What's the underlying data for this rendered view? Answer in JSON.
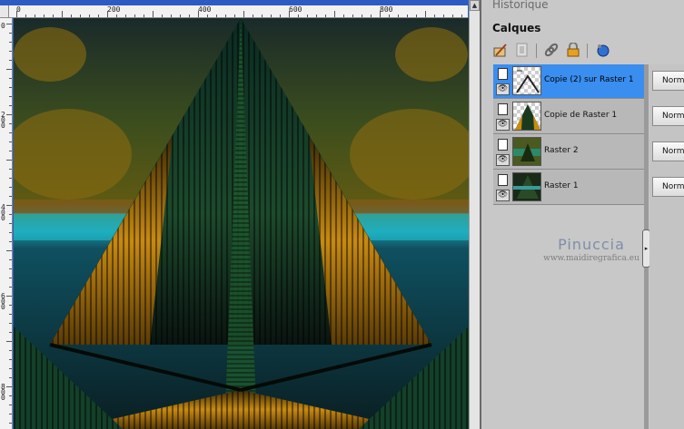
{
  "canvas_window": {
    "ruler_h_labels": [
      "0",
      "200",
      "400",
      "600",
      "800"
    ],
    "ruler_v_labels": [
      "0",
      "2 0 0",
      "4 0 0",
      "6 0 0",
      "8 0 0"
    ],
    "scroll_up_glyph": "▲",
    "image_description_icon": "kaleidoscope-image"
  },
  "palettes": {
    "history_title": "Historique",
    "layers_title": "Calques",
    "toolbar_icons": [
      "new-raster-layer-icon",
      "new-mask-layer-icon",
      "link-icon",
      "lock-icon",
      "layer-effects-icon"
    ],
    "layers": [
      {
        "name": "Copie (2) sur Raster 1",
        "selected": true,
        "blend": "Norm",
        "thumb": "transparent-sketch"
      },
      {
        "name": "Copie de Raster 1",
        "selected": false,
        "blend": "Norm",
        "thumb": "triangle"
      },
      {
        "name": "Raster 2",
        "selected": false,
        "blend": "Norm",
        "thumb": "green-pattern"
      },
      {
        "name": "Raster 1",
        "selected": false,
        "blend": "Norm",
        "thumb": "dark-pattern"
      }
    ],
    "splitter_glyph": "▸",
    "watermark_name": "Pinuccia",
    "watermark_url": "www.maidiregrafica.eu"
  },
  "colors": {
    "selected_layer": "#3a8ef0",
    "window_frame": "#2b5cc4"
  }
}
